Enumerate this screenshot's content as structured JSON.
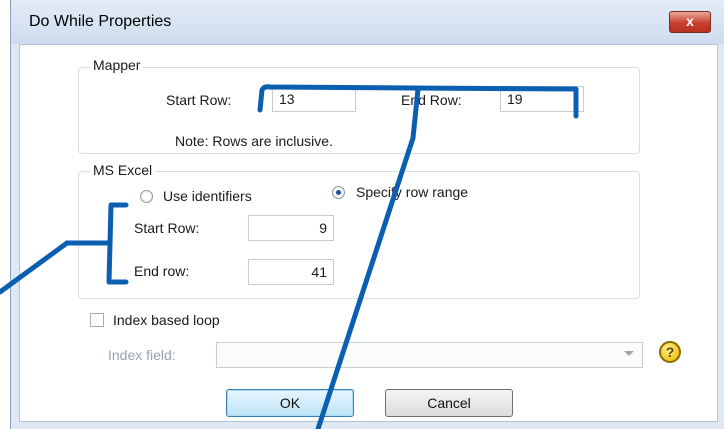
{
  "window": {
    "title": "Do While Properties",
    "close_label": "x"
  },
  "mapper": {
    "legend": "Mapper",
    "start_row_label": "Start Row:",
    "start_row_value": "13",
    "end_row_label": "End Row:",
    "end_row_value": "19",
    "note": "Note: Rows are inclusive."
  },
  "ms_excel": {
    "legend": "MS Excel",
    "use_identifiers_label": "Use identifiers",
    "specify_range_label": "Specify row range",
    "selected": "specify_row_range",
    "start_row_label": "Start Row:",
    "start_row_value": "9",
    "end_row_label": "End row:",
    "end_row_value": "41"
  },
  "index_loop": {
    "checkbox_label": "Index based loop",
    "checked": false,
    "field_label": "Index field:",
    "field_value": ""
  },
  "buttons": {
    "ok": "OK",
    "cancel": "Cancel"
  },
  "colors": {
    "annotation": "#0b5fb0",
    "dialog_bg": "#dfe8f3"
  },
  "icons": [
    "radio-unselected-icon",
    "radio-selected-icon",
    "checkbox-icon",
    "dropdown-arrow-icon",
    "help-icon"
  ]
}
